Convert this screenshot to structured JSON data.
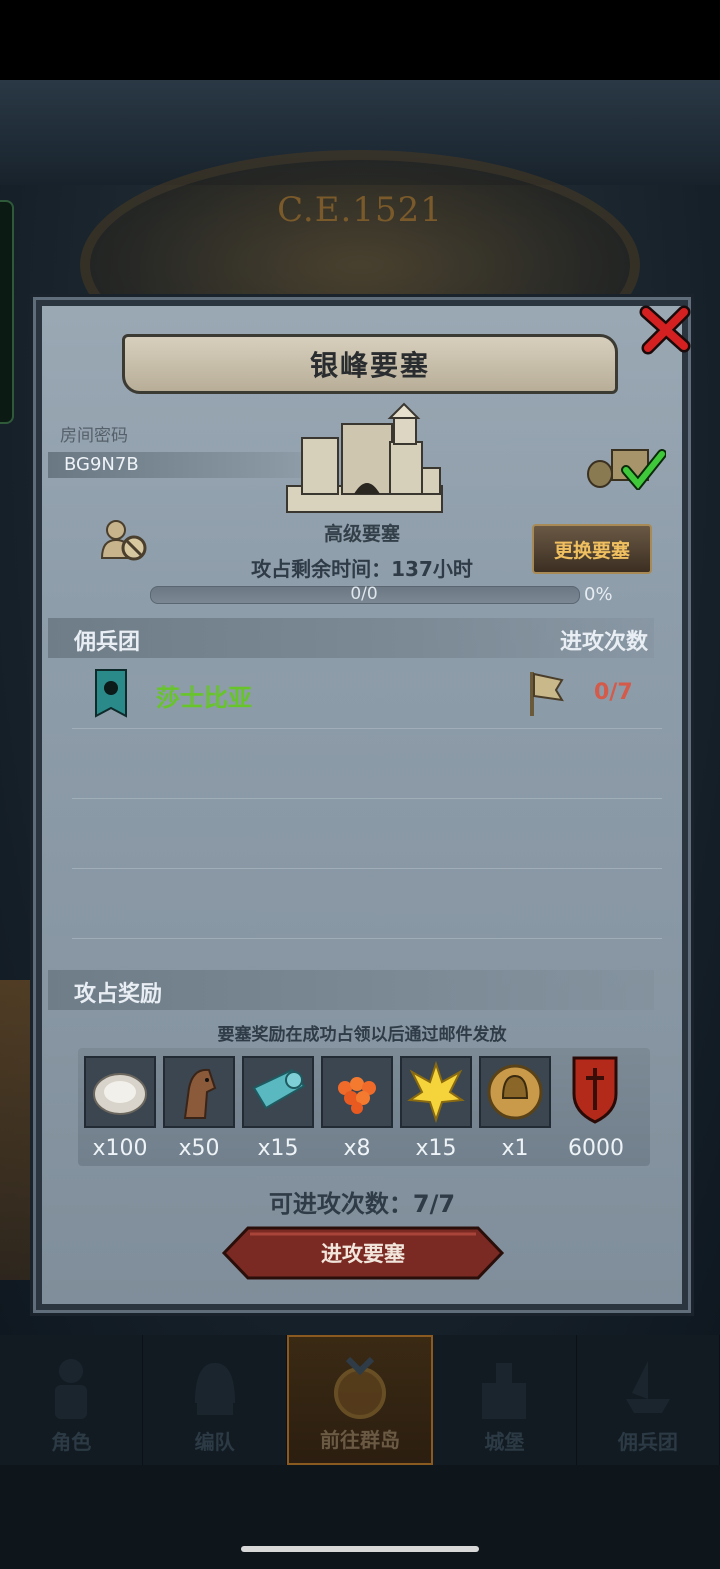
{
  "background": {
    "era_label": "C.E.1521"
  },
  "dialog": {
    "title": "银峰要塞",
    "room_password_label": "房间密码",
    "room_password_value": "BG9N7B",
    "fortress_type": "高级要塞",
    "time_remaining": "攻占剩余时间：137小时",
    "change_button": "更换要塞",
    "progress": {
      "text": "0/0",
      "percent_text": "0%",
      "fraction": 0
    },
    "mercenary_section": {
      "left_label": "佣兵团",
      "right_label": "进攻次数",
      "rows": [
        {
          "name": "莎士比亚",
          "attacks": "0/7"
        }
      ]
    },
    "reward_section": {
      "label": "攻占奖励",
      "note": "要塞奖励在成功占领以后通过邮件发放",
      "items": [
        {
          "icon": "oyster-icon",
          "qty": "x100"
        },
        {
          "icon": "horse-icon",
          "qty": "x50"
        },
        {
          "icon": "cloth-icon",
          "qty": "x15"
        },
        {
          "icon": "roe-icon",
          "qty": "x8"
        },
        {
          "icon": "gold-emblem-icon",
          "qty": "x15"
        },
        {
          "icon": "helmet-coin-icon",
          "qty": "x1"
        },
        {
          "icon": "red-shield-icon",
          "qty": "6000"
        }
      ]
    },
    "attack_attempts": "可进攻次数：7/7",
    "attack_button": "进攻要塞"
  },
  "nav": {
    "items": [
      {
        "label": "角色",
        "active": false
      },
      {
        "label": "编队",
        "active": false
      },
      {
        "label": "前往群岛",
        "active": true
      },
      {
        "label": "城堡",
        "active": false
      },
      {
        "label": "佣兵团",
        "active": false
      }
    ]
  },
  "colors": {
    "accent_green": "#67c42a",
    "accent_red": "#d45a4a",
    "button_gold": "#f0c060"
  }
}
